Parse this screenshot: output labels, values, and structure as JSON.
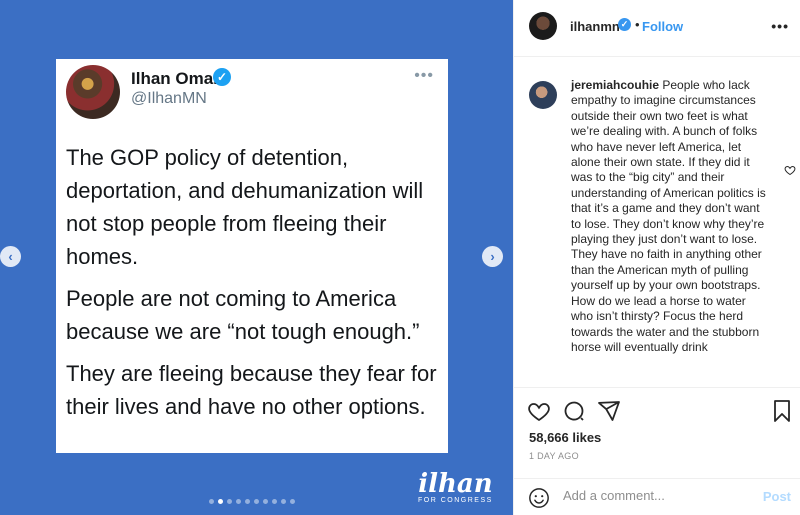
{
  "media": {
    "tweet": {
      "name": "Ilhan Omar",
      "handle": "@IlhanMN",
      "more": "•••",
      "paragraphs": [
        "The GOP policy of detention, deportation, and dehumanization will not stop people from fleeing their homes.",
        "People are not coming to America because we are “not tough enough.”",
        "They are fleeing because they fear for their lives and have no other options."
      ]
    },
    "nav": {
      "prev": "‹",
      "next": "›"
    },
    "carousel": {
      "count": 10,
      "active": 1
    },
    "brand": {
      "logo": "ilhan",
      "sub": "FOR CONGRESS"
    }
  },
  "post": {
    "header": {
      "username": "ilhanmn",
      "separator": "•",
      "follow_label": "Follow",
      "more": "•••"
    },
    "comment": {
      "username": "jeremiahcouhie",
      "text": " People who lack empathy to imagine circumstances outside their own two feet is what we’re dealing with. A bunch of folks who have never left America, let alone their own state. If they did it was to the “big city” and their understanding of American politics is that it’s a game and they don’t want to lose. They don’t know why they’re playing they just don’t want to lose. They have no faith in anything other than the American myth of pulling yourself up by your own bootstraps. How do we lead a horse to water who isn’t thirsty? Focus the herd towards the water and the stubborn horse will eventually drink"
    },
    "likes": "58,666 likes",
    "time": "1 DAY AGO",
    "add_comment": {
      "placeholder": "Add a comment...",
      "post_label": "Post"
    },
    "icons": [
      "heart-icon",
      "comment-icon",
      "share-icon",
      "bookmark-icon",
      "emoji-icon"
    ],
    "colors": {
      "accent": "#3897f0",
      "media_bg": "#3b6fc4"
    }
  }
}
